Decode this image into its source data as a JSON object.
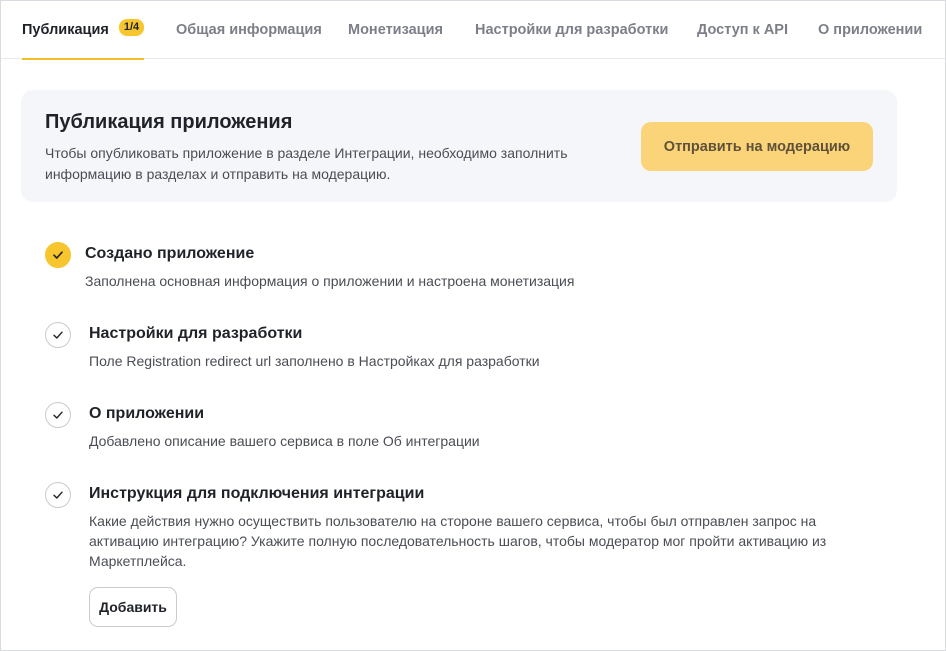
{
  "tabs": [
    {
      "label": "Публикация",
      "badge": "1/4",
      "active": true
    },
    {
      "label": "Общая информация"
    },
    {
      "label": "Монетизация"
    },
    {
      "label": "Настройки для разработки"
    },
    {
      "label": "Доступ к API"
    },
    {
      "label": "О приложении"
    }
  ],
  "publish_card": {
    "title": "Публикация приложения",
    "description": "Чтобы опубликовать приложение в разделе Интеграции, необходимо заполнить информацию в разделах и отправить на модерацию.",
    "submit_label": "Отправить на модерацию"
  },
  "steps": [
    {
      "title": "Создано приложение",
      "description": "Заполнена основная информация о приложении и настроена монетизация",
      "done": true
    },
    {
      "title": "Настройки для разработки",
      "description": "Поле Registration redirect url заполнено в Настройках для разработки",
      "done": false
    },
    {
      "title": "О приложении",
      "description": "Добавлено описание вашего сервиса в поле Об интеграции",
      "done": false
    },
    {
      "title": "Инструкция для подключения интеграции",
      "description": "Какие действия нужно осуществить пользователю на стороне вашего сервиса, чтобы был отправлен запрос на активацию интеграцию? Укажите полную последовательность шагов, чтобы модератор мог пройти активацию из Маркетплейса.",
      "done": false,
      "action_label": "Добавить"
    }
  ],
  "colors": {
    "accent": "#f7c52e",
    "button_disabled": "#fbd47a",
    "card_background": "#f5f6f9"
  },
  "icons": {
    "check": "check-icon"
  }
}
